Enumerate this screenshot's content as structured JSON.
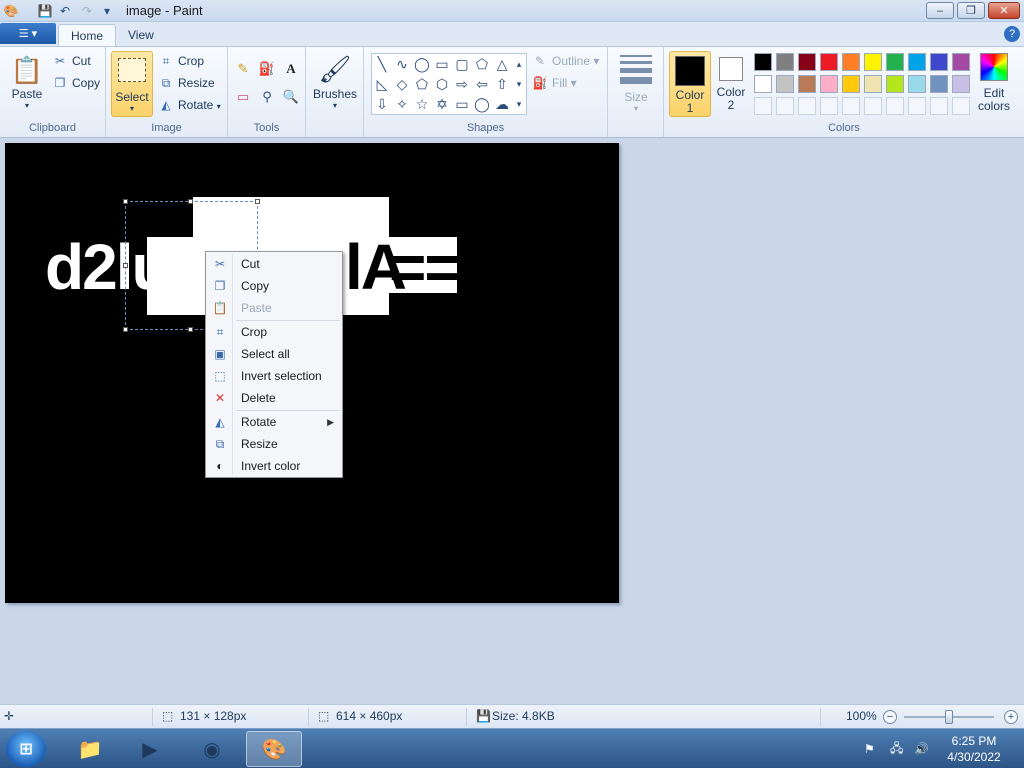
{
  "window": {
    "title": "image - Paint",
    "minimize": "–",
    "maximize": "❐",
    "close": "✕"
  },
  "tabs": [
    {
      "label": "Home",
      "active": true
    },
    {
      "label": "View",
      "active": false
    }
  ],
  "ribbon": {
    "clipboard": {
      "label": "Clipboard",
      "paste": "Paste",
      "cut": "Cut",
      "copy": "Copy"
    },
    "image": {
      "label": "Image",
      "select": "Select",
      "crop": "Crop",
      "resize": "Resize",
      "rotate": "Rotate"
    },
    "tools": {
      "label": "Tools"
    },
    "brushes": {
      "label": "Brushes"
    },
    "shapes": {
      "label": "Shapes",
      "outline": "Outline",
      "fill": "Fill"
    },
    "size": {
      "label": "Size"
    },
    "colors": {
      "label": "Colors",
      "color1": "Color 1",
      "color1_a": "Color",
      "color1_b": "1",
      "color2_a": "Color",
      "color2_b": "2",
      "edit_a": "Edit",
      "edit_b": "colors",
      "palette_row1": [
        "#000000",
        "#7f7f7f",
        "#880015",
        "#ed1c24",
        "#ff7f27",
        "#fff200",
        "#22b14c",
        "#00a2e8",
        "#3f48cc",
        "#a349a4"
      ],
      "palette_row2": [
        "#ffffff",
        "#c3c3c3",
        "#b97a57",
        "#ffaec9",
        "#ffc90e",
        "#efe4b0",
        "#b5e61d",
        "#99d9ea",
        "#7092be",
        "#c8bfe7"
      ]
    }
  },
  "canvas_image": {
    "text_left": "d2lua",
    "text_right": "==",
    "text_mid": "lA"
  },
  "context_menu": {
    "items": [
      {
        "label": "Cut",
        "icon": "scissors-icon",
        "enabled": true
      },
      {
        "label": "Copy",
        "icon": "copy-icon",
        "enabled": true
      },
      {
        "label": "Paste",
        "icon": "paste-icon",
        "enabled": false
      },
      {
        "label": "Crop",
        "icon": "crop-icon",
        "enabled": true
      },
      {
        "label": "Select all",
        "icon": "select-all-icon",
        "enabled": true
      },
      {
        "label": "Invert selection",
        "icon": "invert-selection-icon",
        "enabled": true
      },
      {
        "label": "Delete",
        "icon": "delete-icon",
        "enabled": true
      },
      {
        "label": "Rotate",
        "icon": "rotate-icon",
        "enabled": true,
        "submenu": true
      },
      {
        "label": "Resize",
        "icon": "resize-icon",
        "enabled": true
      },
      {
        "label": "Invert color",
        "icon": "invert-color-icon",
        "enabled": true
      }
    ]
  },
  "statusbar": {
    "selection_size": "131 × 128px",
    "image_size": "614 × 460px",
    "file_size": "Size: 4.8KB",
    "zoom": "100%"
  },
  "taskbar": {
    "time": "6:25 PM",
    "date": "4/30/2022"
  }
}
